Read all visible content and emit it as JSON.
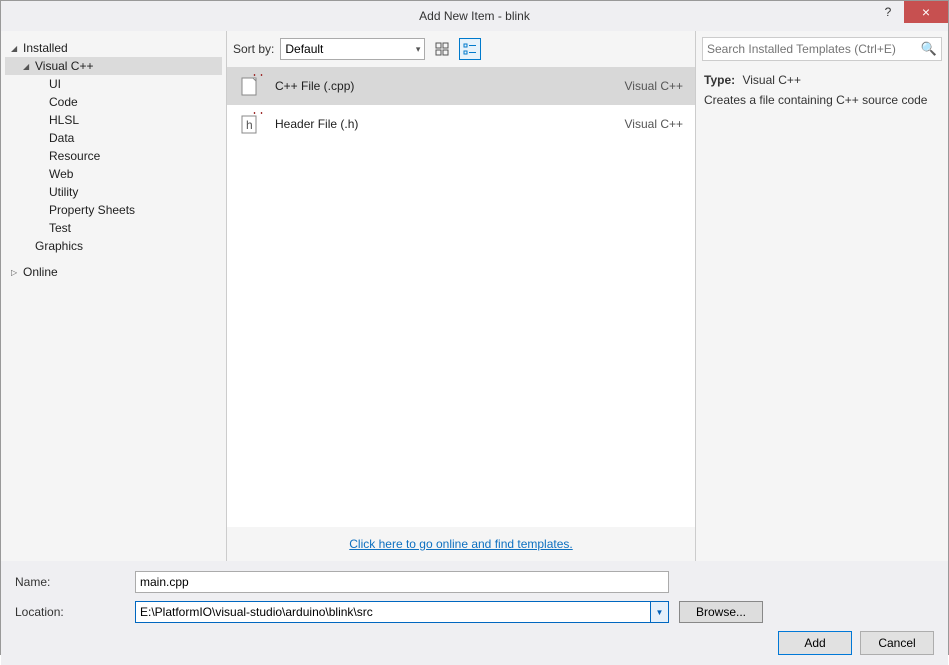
{
  "titlebar": {
    "title": "Add New Item - blink",
    "help": "?",
    "close": "×"
  },
  "sidebar": {
    "installed": "Installed",
    "vcpp": "Visual C++",
    "children": [
      "UI",
      "Code",
      "HLSL",
      "Data",
      "Resource",
      "Web",
      "Utility",
      "Property Sheets",
      "Test"
    ],
    "graphics": "Graphics",
    "online": "Online"
  },
  "toolbar": {
    "sort_label": "Sort by:",
    "sort_value": "Default"
  },
  "templates": [
    {
      "name": "C++ File (.cpp)",
      "lang": "Visual C++",
      "icon": "cpp"
    },
    {
      "name": "Header File (.h)",
      "lang": "Visual C++",
      "icon": "h"
    }
  ],
  "online_link": "Click here to go online and find templates.",
  "search": {
    "placeholder": "Search Installed Templates (Ctrl+E)"
  },
  "info": {
    "type_label": "Type:",
    "type_value": "Visual C++",
    "desc": "Creates a file containing C++ source code"
  },
  "form": {
    "name_label": "Name:",
    "name_value": "main.cpp",
    "location_label": "Location:",
    "location_value": "E:\\PlatformIO\\visual-studio\\arduino\\blink\\src",
    "browse": "Browse..."
  },
  "actions": {
    "add": "Add",
    "cancel": "Cancel"
  }
}
